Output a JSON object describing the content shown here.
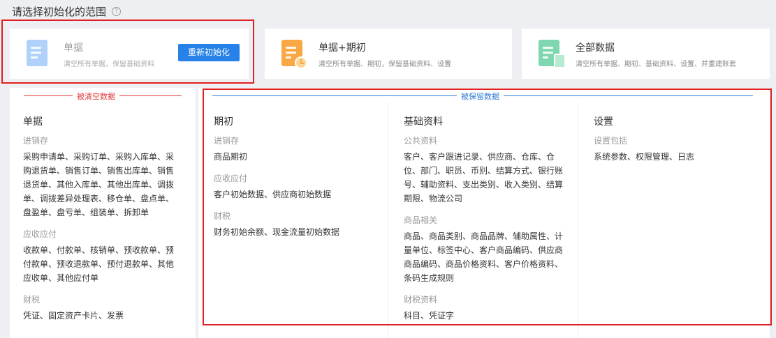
{
  "header": {
    "title": "请选择初始化的范围",
    "help_icon": "?"
  },
  "options": [
    {
      "title": "单据",
      "desc": "清空所有单据，保留基础资料",
      "button": "重新初始化",
      "icon": "document-icon"
    },
    {
      "title": "单据+期初",
      "desc": "清空所有单据、期初，保留基础资料、设置",
      "icon": "document-clock-icon"
    },
    {
      "title": "全部数据",
      "desc": "清空所有单据、期初、基础资料、设置、并重建账套",
      "icon": "documents-icon"
    }
  ],
  "cleared": {
    "label": "被清空数据",
    "title": "单据",
    "groups": [
      {
        "title": "进销存",
        "text": "采购申请单、采购订单、采购入库单、采购退货单、销售订单、销售出库单、销售退货单、其他入库单、其他出库单、调拨单、调拨差异处理表、移仓单、盘点单、盘盈单、盘亏单、组装单、拆卸单"
      },
      {
        "title": "应收应付",
        "text": "收款单、付款单、核销单、预收款单、预付款单、预收退款单、预付退款单、其他应收单、其他应付单"
      },
      {
        "title": "财税",
        "text": "凭证、固定资产卡片、发票"
      }
    ]
  },
  "kept": {
    "label": "被保留数据",
    "columns": [
      {
        "title": "期初",
        "groups": [
          {
            "title": "进销存",
            "text": "商品期初"
          },
          {
            "title": "应收应付",
            "text": "客户初始数据、供应商初始数据"
          },
          {
            "title": "财税",
            "text": "财务初始余额、现金流量初始数据"
          }
        ]
      },
      {
        "title": "基础资料",
        "groups": [
          {
            "title": "公共资料",
            "text": "客户、客户跟进记录、供应商、仓库、仓位、部门、职员、币别、结算方式、银行账号、辅助资料、支出类别、收入类别、结算期限、物流公司"
          },
          {
            "title": "商品相关",
            "text": "商品、商品类别、商品品牌、辅助属性、计量单位、标签中心、客户商品编码、供应商商品编码、商品价格资料、客户价格资料、条码生成规则"
          },
          {
            "title": "财税资料",
            "text": "科目、凭证字"
          }
        ]
      },
      {
        "title": "设置",
        "groups": [
          {
            "title": "设置包括",
            "text": "系统参数、权限管理、日志"
          }
        ]
      }
    ]
  },
  "colors": {
    "accent": "#2681e8",
    "cleared": "#e03a3a",
    "kept": "#2e7bd6",
    "highlight": "#e02020"
  }
}
